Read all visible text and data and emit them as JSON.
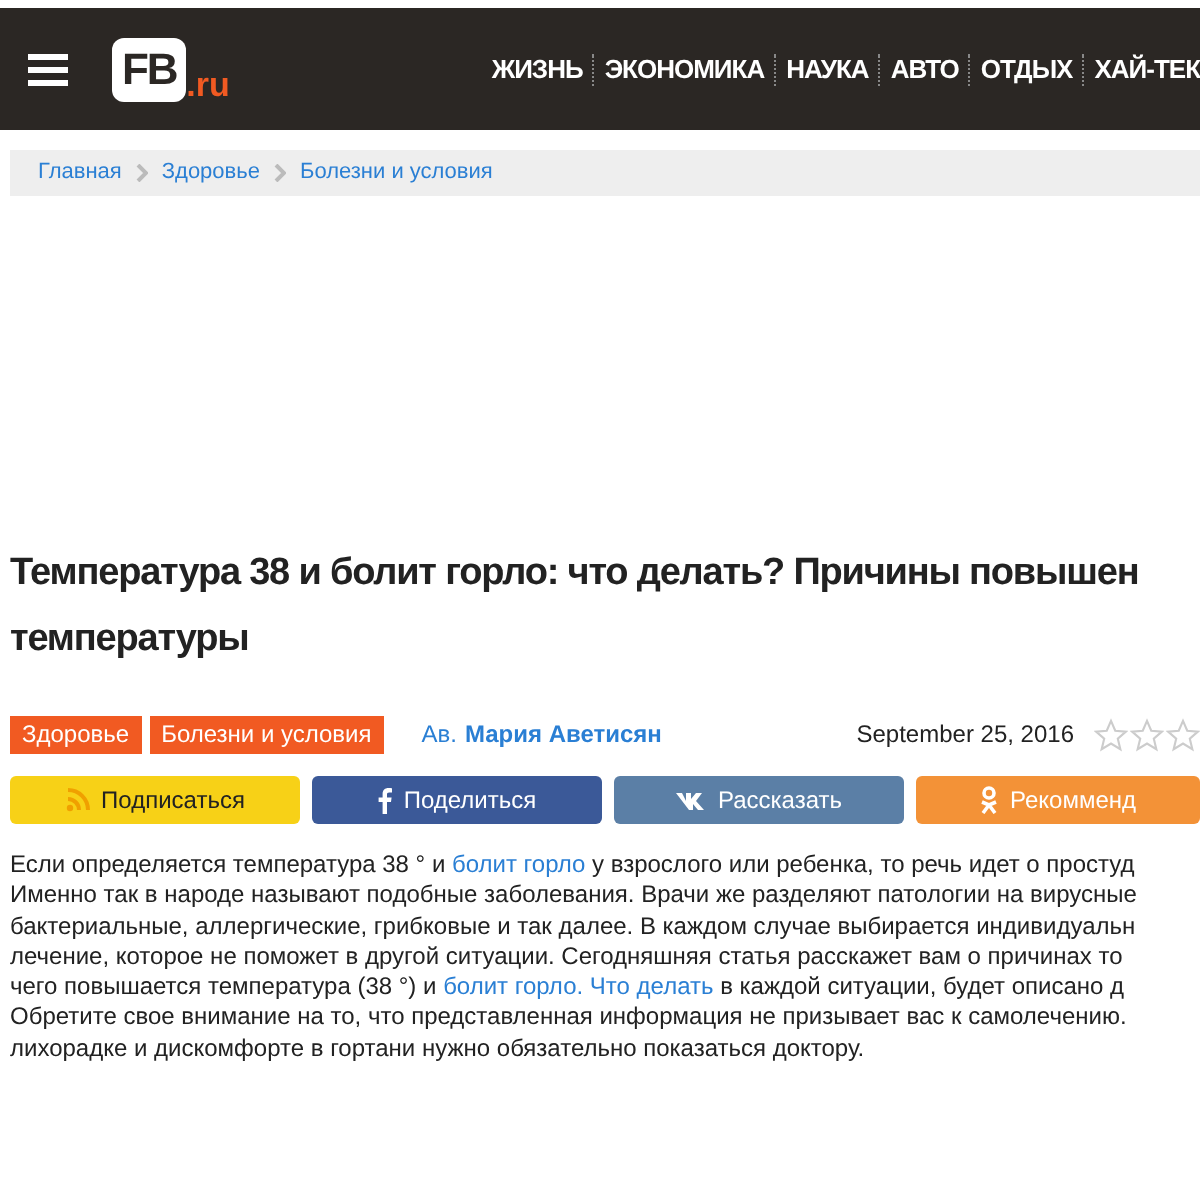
{
  "header": {
    "logo": {
      "mark": "FB",
      "suffix": ".ru"
    },
    "nav": [
      "ЖИЗНЬ",
      "ЭКОНОМИКА",
      "НАУКА",
      "АВТО",
      "ОТДЫХ",
      "ХАЙ-ТЕК"
    ]
  },
  "breadcrumbs": [
    "Главная",
    "Здоровье",
    "Болезни и условия"
  ],
  "article": {
    "title_lines": [
      "Температура 38 и болит горло: что делать? Причины повышен",
      "температуры"
    ],
    "tags": [
      "Здоровье",
      "Болезни и условия"
    ],
    "author_prefix": "Ав.",
    "author": "Мария Аветисян",
    "date": "September 25, 2016",
    "stars": 0,
    "share_buttons": [
      {
        "kind": "rss",
        "label": "Подписаться"
      },
      {
        "kind": "facebook",
        "label": "Поделиться"
      },
      {
        "kind": "vk",
        "label": "Рассказать"
      },
      {
        "kind": "ok",
        "label": "Рекомменд"
      }
    ],
    "paragraph_lines": [
      [
        {
          "text": "Если определяется температура 38 ° и "
        },
        {
          "text": "болит горло",
          "link": true
        },
        {
          "text": " у взрослого или ребенка, то речь идет о простуд"
        }
      ],
      [
        {
          "text": "Именно так в народе называют подобные заболевания. Врачи же разделяют патологии на вирусные"
        }
      ],
      [
        {
          "text": "бактериальные, аллергические, грибковые и так далее. В каждом случае выбирается индивидуальн"
        }
      ],
      [
        {
          "text": "лечение, которое не поможет в другой ситуации. Сегодняшняя статья расскажет вам о причинах то"
        }
      ],
      [
        {
          "text": "чего повышается температура (38 °) и "
        },
        {
          "text": "болит горло.",
          "link": true
        },
        {
          "text": "Что делать",
          "link": true
        },
        {
          "text": " в каждой ситуации, будет описано д"
        }
      ],
      [
        {
          "text": "Обретите свое внимание на то, что представленная информация не призывает вас к самолечению."
        }
      ],
      [
        {
          "text": "лихорадке и дискомфорте в гортани нужно обязательно показаться доктору."
        }
      ]
    ]
  }
}
